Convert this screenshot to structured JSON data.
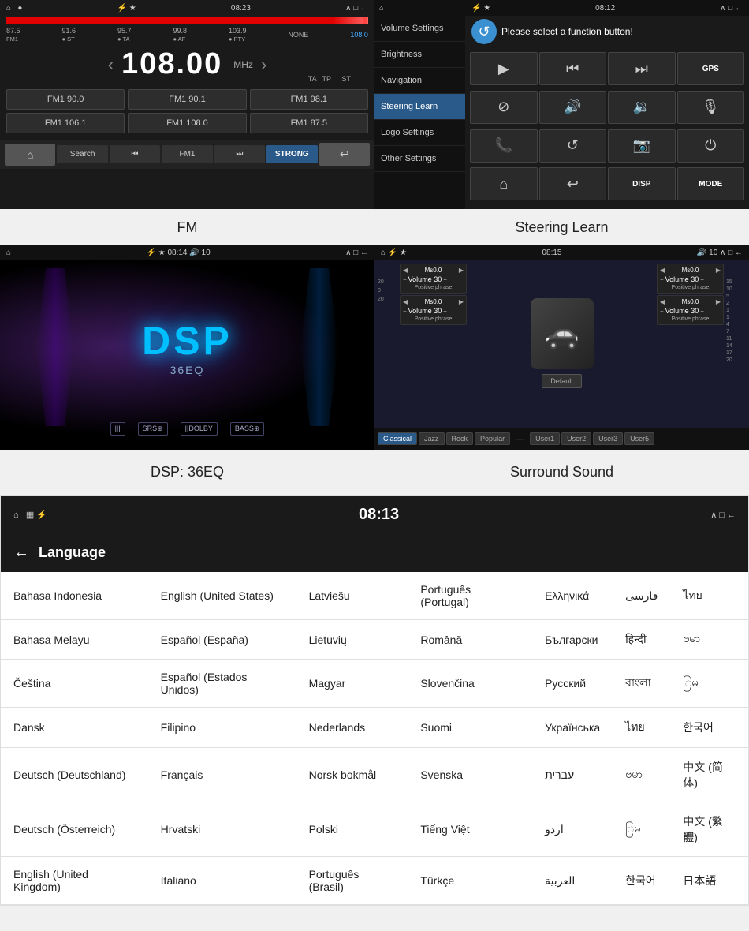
{
  "fm": {
    "title": "FM",
    "time": "08:23",
    "frequency": "108.00",
    "unit": "MHz",
    "indicators": [
      "TA",
      "TP",
      "ST"
    ],
    "af_label": "AF",
    "pty_label": "PTY",
    "freq_marks": [
      "87.5",
      "91.6",
      "95.7",
      "99.8",
      "103.9",
      "NONE",
      "108.0"
    ],
    "presets": [
      "FM1 90.0",
      "FM1 90.1",
      "FM1 98.1",
      "FM1 106.1",
      "FM1 108.0",
      "FM1 87.5"
    ],
    "controls": [
      "🏠",
      "Search",
      "⏮",
      "FM1",
      "⏭",
      "STRONG",
      "↩"
    ],
    "caption": "FM"
  },
  "steering": {
    "title": "Steering Learn",
    "time": "08:12",
    "prompt": "Please select a function button!",
    "menu_items": [
      "Volume Settings",
      "Brightness",
      "Navigation",
      "Steering Learn",
      "Logo Settings",
      "Other Settings"
    ],
    "active_menu": "Steering Learn",
    "buttons": [
      {
        "icon": "▶",
        "label": "play"
      },
      {
        "icon": "⏮",
        "label": "prev"
      },
      {
        "icon": "⏭",
        "label": "next"
      },
      {
        "icon": "GPS",
        "label": "GPS"
      },
      {
        "icon": "⊘",
        "label": "mute"
      },
      {
        "icon": "🔊",
        "label": "vol-up"
      },
      {
        "icon": "🔉",
        "label": "vol-down"
      },
      {
        "icon": "🎙",
        "label": "mic"
      },
      {
        "icon": "📞",
        "label": "phone"
      },
      {
        "icon": "↺",
        "label": "rotate"
      },
      {
        "icon": "📷",
        "label": "camera"
      },
      {
        "icon": "⏻",
        "label": "power"
      },
      {
        "icon": "⌂",
        "label": "home"
      },
      {
        "icon": "↩",
        "label": "back"
      },
      {
        "icon": "DISP",
        "label": "DISP"
      },
      {
        "icon": "MODE",
        "label": "MODE"
      }
    ],
    "caption": "Steering Learn"
  },
  "dsp": {
    "title": "DSP",
    "eq_label": "36EQ",
    "time": "08:14",
    "volume": "10",
    "badges": [
      "|||",
      "SRS⊕",
      "||DOLBY",
      "BASS⊕"
    ],
    "caption": "DSP: 36EQ"
  },
  "surround": {
    "title": "Surround Sound",
    "time": "08:15",
    "volume": "10",
    "units": [
      {
        "ms": "Ms0.0",
        "vol": "Volume 30",
        "phrase": "Positive phrase"
      },
      {
        "ms": "Ms0.0",
        "vol": "Volume 30",
        "phrase": "Positive phrase"
      },
      {
        "ms": "Ms0.0",
        "vol": "Volume 30",
        "phrase": "Positive phrase"
      },
      {
        "ms": "Ms0.0",
        "vol": "Volume 30",
        "phrase": "Positive phrase"
      }
    ],
    "default_btn": "Default",
    "tabs": [
      "Classical",
      "Jazz",
      "Rock",
      "Popular",
      "",
      "User1",
      "User2",
      "User3",
      "User5"
    ],
    "active_tab": "Classical",
    "caption": "Surround Sound"
  },
  "language": {
    "title": "Language",
    "time": "08:13",
    "back_label": "←",
    "rows": [
      [
        "Bahasa Indonesia",
        "English (United States)",
        "Latviešu",
        "Português (Portugal)",
        "Ελληνικά",
        "فارسی",
        "ไทย"
      ],
      [
        "Bahasa Melayu",
        "Español (España)",
        "Lietuvių",
        "Română",
        "Български",
        "हिन्दी",
        "ဗမာ"
      ],
      [
        "Čeština",
        "Español (Estados Unidos)",
        "Magyar",
        "Slovenčina",
        "Русский",
        "বাংলা",
        "ြမ"
      ],
      [
        "Dansk",
        "Filipino",
        "Nederlands",
        "Suomi",
        "Українська",
        "ไทย",
        "한국어"
      ],
      [
        "Deutsch (Deutschland)",
        "Français",
        "Norsk bokmål",
        "Svenska",
        "עברית",
        "ဗမာ",
        "中文 (简体)"
      ],
      [
        "Deutsch (Österreich)",
        "Hrvatski",
        "Polski",
        "Tiếng Việt",
        "اردو",
        "ြမ",
        "中文 (繁體)"
      ],
      [
        "English (United Kingdom)",
        "Italiano",
        "Português (Brasil)",
        "Türkçe",
        "العربية",
        "한국어",
        "日本語"
      ]
    ]
  }
}
